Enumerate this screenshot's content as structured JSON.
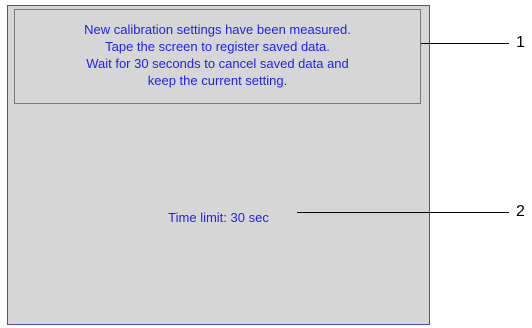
{
  "message": {
    "lines": [
      "New calibration settings have been measured.",
      "Tape the screen to register saved data.",
      "Wait for 30 seconds to cancel saved data and",
      "keep the current setting."
    ]
  },
  "time_limit": "Time limit: 30 sec",
  "callouts": [
    "1",
    "2"
  ]
}
